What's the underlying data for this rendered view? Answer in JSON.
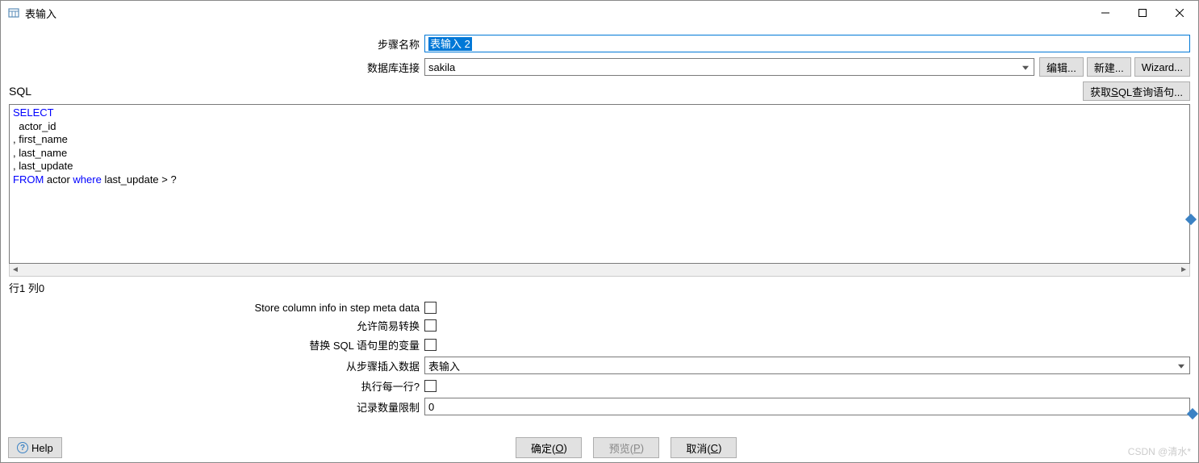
{
  "window": {
    "title": "表输入"
  },
  "form": {
    "step_name_label": "步骤名称",
    "step_name_value": "表输入 2",
    "connection_label": "数据库连接",
    "connection_value": "sakila",
    "edit_btn": "编辑...",
    "new_btn": "新建...",
    "wizard_btn": "Wizard..."
  },
  "sql": {
    "label": "SQL",
    "get_query_btn_prefix": "获取",
    "get_query_btn_u": "S",
    "get_query_btn_suffix": "QL查询语句...",
    "kw_select": "SELECT",
    "line2": "  actor_id",
    "line3": ", first_name",
    "line4": ", last_name",
    "line5": ", last_update",
    "kw_from": "FROM",
    "from_mid": " actor ",
    "kw_where": "where",
    "from_tail": " last_update > ?",
    "status": "行1 列0"
  },
  "options": {
    "store_meta": "Store column info in step meta data",
    "lazy_conversion": "允许简易转换",
    "replace_vars": "替换 SQL 语句里的变量",
    "insert_from_step": "从步骤插入数据",
    "insert_from_step_value": "表输入",
    "execute_each_row": "执行每一行?",
    "limit_label": "记录数量限制",
    "limit_value": "0"
  },
  "footer": {
    "help": "Help",
    "ok_prefix": "确定(",
    "ok_u": "O",
    "ok_suffix": ")",
    "preview_prefix": "预览(",
    "preview_u": "P",
    "preview_suffix": ")",
    "cancel_prefix": "取消(",
    "cancel_u": "C",
    "cancel_suffix": ")"
  },
  "watermark": "CSDN @清水*"
}
